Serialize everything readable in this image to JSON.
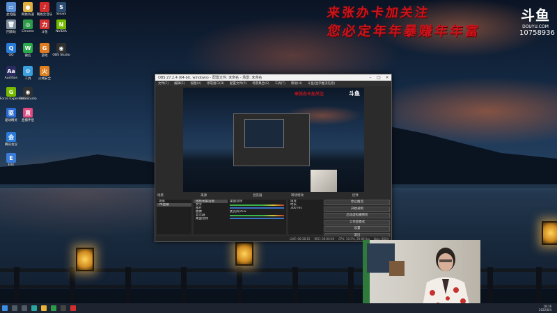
{
  "overlay": {
    "calligraphy_line1": "来张办卡加关注",
    "calligraphy_line2": "您必定年年暴赚年年富",
    "logo_text": "斗鱼",
    "logo_url": "DOUYU.COM",
    "room_id": "10758936"
  },
  "desktop_icons": [
    {
      "label": "此电脑",
      "color": "#5a8fd6",
      "glyph": "▭"
    },
    {
      "label": "网易有道",
      "color": "#e0b040",
      "glyph": "●"
    },
    {
      "label": "网易云音乐",
      "color": "#d22b2b",
      "glyph": "♪"
    },
    {
      "label": "Steam",
      "color": "#2a4a70",
      "glyph": "S"
    },
    {
      "label": "回收站",
      "color": "#8090a0",
      "glyph": "🗑"
    },
    {
      "label": "Chrome",
      "color": "#2d9b4a",
      "glyph": "◎"
    },
    {
      "label": "斗鱼",
      "color": "#d23030",
      "glyph": "力"
    },
    {
      "label": "NVIDIA",
      "color": "#76b900",
      "glyph": "N"
    },
    {
      "label": "QQ",
      "color": "#2a7bd8",
      "glyph": "Q"
    },
    {
      "label": "微信",
      "color": "#2aa84a",
      "glyph": "W"
    },
    {
      "label": "游戏",
      "color": "#e07a20",
      "glyph": "G"
    },
    {
      "label": "OBS Studio",
      "color": "#303030",
      "glyph": "◉"
    },
    {
      "label": "Audition",
      "color": "#2a2a60",
      "glyph": "Aa"
    },
    {
      "label": "工具",
      "color": "#3aa0e0",
      "glyph": "⚙"
    },
    {
      "label": "火绒安全",
      "color": "#e08020",
      "glyph": "火"
    },
    {
      "label": "GeForce Experience",
      "color": "#76b900",
      "glyph": "G"
    },
    {
      "label": "OBS Studio",
      "color": "#303030",
      "glyph": "◉"
    },
    {
      "label": "驱动精灵",
      "color": "#2a6ad0",
      "glyph": "驱"
    },
    {
      "label": "直播伴侣",
      "color": "#e04a80",
      "glyph": "直"
    },
    {
      "label": "腾讯会议",
      "color": "#2a7bd8",
      "glyph": "会"
    },
    {
      "label": "EXE",
      "color": "#3a7bd8",
      "glyph": "E"
    }
  ],
  "obs": {
    "title": "OBS 27.2.4 (64-bit, windows) - 配置文件: 未命名 - 场景: 未命名",
    "menu": [
      "文件(F)",
      "编辑(E)",
      "视图(V)",
      "停靠窗口(D)",
      "配置文件(P)",
      "场景集合(S)",
      "工具(T)",
      "帮助(H)",
      "斗鱼(显示推流信息)"
    ],
    "preview_calligraphy": "来张办卡加关注",
    "preview_logo": "斗鱼",
    "panels": {
      "scenes_header": "场景",
      "sources_header": "来源",
      "mixer_header": "混音器",
      "transitions_header": "转场特效",
      "controls_header": "控件"
    },
    "scenes": [
      "场景",
      "PK直播"
    ],
    "sources": [
      "视频采集设备",
      "文字",
      "图片",
      "图像",
      "显示器",
      "桌面音频"
    ],
    "mixer": [
      "桌面音频",
      "麦克风/Aux"
    ],
    "transitions": {
      "type": "渐变",
      "duration_label": "时长",
      "duration": "300 ms"
    },
    "controls": [
      "停止推流",
      "开始录制",
      "启动虚拟摄像机",
      "工作室模式",
      "设置",
      "退出"
    ],
    "status": [
      "LIVE: 00:38:15",
      "REC: 00:00:00",
      "CPU: 10.5%, 30.00 fps",
      "kb/s: 6024"
    ]
  },
  "taskbar": {
    "time": "18:16",
    "date": "2022/6/4"
  }
}
